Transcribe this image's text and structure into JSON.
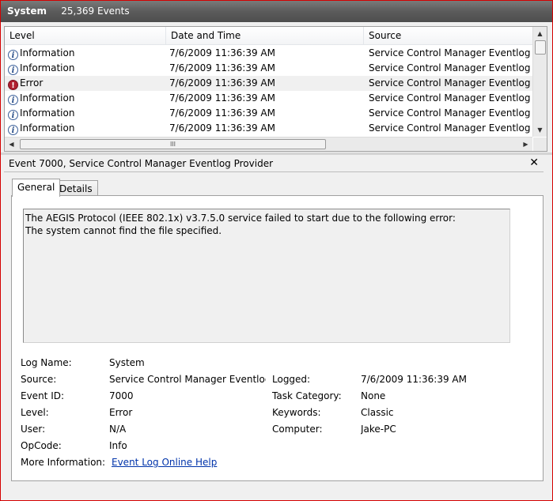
{
  "title": {
    "log": "System",
    "event_count": "25,369 Events"
  },
  "columns": {
    "level": "Level",
    "datetime": "Date and Time",
    "source": "Source"
  },
  "rows": [
    {
      "level": "Information",
      "icon": "info-icon",
      "datetime": "7/6/2009 11:36:39 AM",
      "source": "Service Control Manager Eventlog Provider"
    },
    {
      "level": "Information",
      "icon": "info-icon",
      "datetime": "7/6/2009 11:36:39 AM",
      "source": "Service Control Manager Eventlog Provider"
    },
    {
      "level": "Error",
      "icon": "error-icon",
      "datetime": "7/6/2009 11:36:39 AM",
      "source": "Service Control Manager Eventlog Provider"
    },
    {
      "level": "Information",
      "icon": "info-icon",
      "datetime": "7/6/2009 11:36:39 AM",
      "source": "Service Control Manager Eventlog Provider"
    },
    {
      "level": "Information",
      "icon": "info-icon",
      "datetime": "7/6/2009 11:36:39 AM",
      "source": "Service Control Manager Eventlog Provider"
    },
    {
      "level": "Information",
      "icon": "info-icon",
      "datetime": "7/6/2009 11:36:39 AM",
      "source": "Service Control Manager Eventlog Provider"
    }
  ],
  "scrollbar": {
    "h_grip": "III"
  },
  "detail": {
    "header": "Event 7000, Service Control Manager Eventlog Provider",
    "close_glyph": "✕",
    "tabs": {
      "general": "General",
      "details": "Details"
    },
    "description": "The AEGIS Protocol (IEEE 802.1x) v3.7.5.0 service failed to start due to the following error:\nThe system cannot find the file specified.",
    "fields": {
      "log_name": {
        "label": "Log Name:",
        "value": "System"
      },
      "source": {
        "label": "Source:",
        "value": "Service Control Manager Eventlog Provider"
      },
      "event_id": {
        "label": "Event ID:",
        "value": "7000"
      },
      "level": {
        "label": "Level:",
        "value": "Error"
      },
      "user": {
        "label": "User:",
        "value": "N/A"
      },
      "opcode": {
        "label": "OpCode:",
        "value": "Info"
      },
      "more_info": {
        "label": "More Information:",
        "value": "Event Log Online Help"
      },
      "logged": {
        "label": "Logged:",
        "value": "7/6/2009 11:36:39 AM"
      },
      "task_category": {
        "label": "Task Category:",
        "value": "None"
      },
      "keywords": {
        "label": "Keywords:",
        "value": "Classic"
      },
      "computer": {
        "label": "Computer:",
        "value": "Jake-PC"
      }
    }
  },
  "colors": {
    "frame_border": "#d40000",
    "link": "#0033aa",
    "error_icon": "#b02030",
    "info_icon": "#3a5f9a"
  }
}
